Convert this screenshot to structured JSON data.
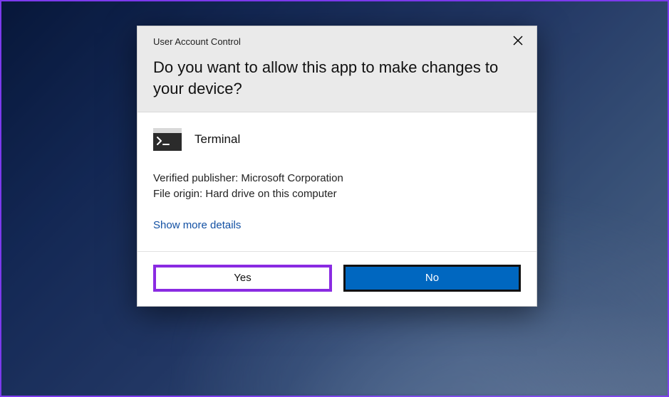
{
  "dialog": {
    "title_bar": "User Account Control",
    "question": "Do you want to allow this app to make changes to your device?",
    "app": {
      "name": "Terminal",
      "icon": "terminal-icon"
    },
    "publisher_label": "Verified publisher:",
    "publisher_value": "Microsoft Corporation",
    "origin_label": "File origin:",
    "origin_value": "Hard drive on this computer",
    "details_link": "Show more details",
    "buttons": {
      "yes": "Yes",
      "no": "No"
    },
    "close_icon": "close-icon"
  },
  "colors": {
    "accent_blue": "#0067c0",
    "highlight_purple": "#8a2be2",
    "link_blue": "#1250a3"
  }
}
